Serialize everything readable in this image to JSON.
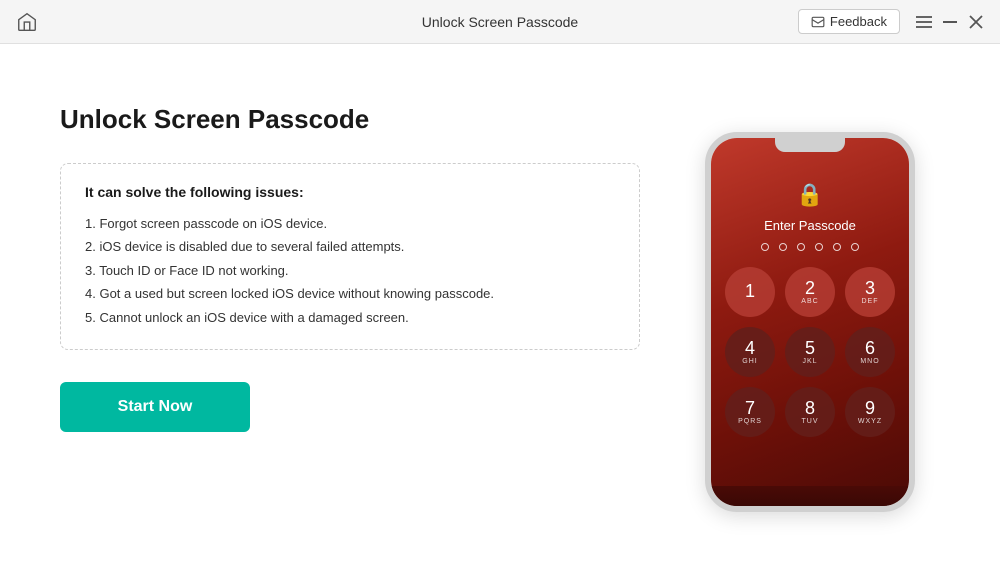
{
  "titlebar": {
    "title": "Unlock Screen Passcode",
    "feedback_label": "Feedback",
    "minimize_label": "—",
    "maximize_label": "⬜",
    "close_label": "✕"
  },
  "main": {
    "page_title": "Unlock Screen Passcode",
    "issues_title": "It can solve the following issues:",
    "issues": [
      "1. Forgot screen passcode on iOS device.",
      "2. iOS device is disabled due to several failed attempts.",
      "3. Touch ID or Face ID not working.",
      "4. Got a used but screen locked iOS device without knowing passcode.",
      "5. Cannot unlock an iOS device with a damaged screen."
    ],
    "start_button": "Start Now"
  },
  "phone": {
    "enter_passcode": "Enter Passcode",
    "numpad": [
      {
        "main": "1",
        "sub": ""
      },
      {
        "main": "2",
        "sub": "ABC"
      },
      {
        "main": "3",
        "sub": "DEF"
      },
      {
        "main": "4",
        "sub": "GHI"
      },
      {
        "main": "5",
        "sub": "JKL"
      },
      {
        "main": "6",
        "sub": "MNO"
      },
      {
        "main": "7",
        "sub": "PQRS"
      },
      {
        "main": "8",
        "sub": "TUV"
      },
      {
        "main": "9",
        "sub": "WXYZ"
      }
    ]
  }
}
